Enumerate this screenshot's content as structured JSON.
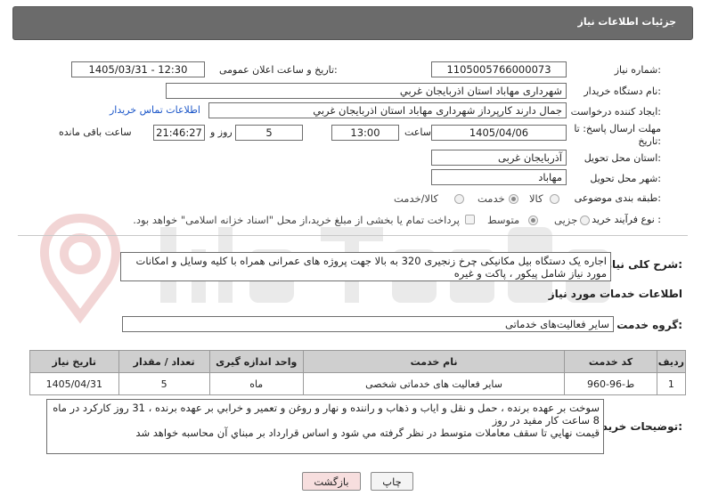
{
  "header": {
    "title": "جزئیات اطلاعات نیاز"
  },
  "form": {
    "need_number": {
      "label": "شماره نیاز:",
      "value": "1105005766000073"
    },
    "announce_datetime": {
      "label": "تاریخ و ساعت اعلان عمومی:",
      "value": "1405/03/31 - 12:30"
    },
    "buyer_org": {
      "label": "نام دستگاه خریدار:",
      "value": "شهرداری مهاباد استان اذربایجان غربي"
    },
    "requester": {
      "label": "ایجاد کننده درخواست:",
      "value": "جمال دارند کارپرداز  شهرداری مهاباد استان اذربایجان غربي",
      "contact_link": "اطلاعات تماس خریدار"
    },
    "deadline": {
      "label_line1": "مهلت ارسال پاسخ: تا",
      "label_line2": "تاریخ:",
      "date": "1405/04/06",
      "time_label": "ساعت",
      "time": "13:00",
      "days": "5",
      "days_label": "روز و",
      "remaining": "21:46:27",
      "remaining_label": "ساعت باقی مانده"
    },
    "province": {
      "label": "استان محل تحویل:",
      "value": "آذربایجان غربی"
    },
    "city": {
      "label": "شهر محل تحویل:",
      "value": "مهاباد"
    },
    "category": {
      "label": "طبقه بندی موضوعی:",
      "options": [
        "کالا",
        "خدمت",
        "کالا/خدمت"
      ],
      "selected": "خدمت"
    },
    "purchase_type": {
      "label": "نوع فرآیند خرید :",
      "options": [
        "جزیی",
        "متوسط"
      ],
      "selected": "متوسط",
      "payment_note": "پرداخت تمام یا بخشی از مبلغ خرید،از محل \"اسناد خزانه اسلامی\" خواهد بود."
    }
  },
  "description": {
    "label": "شرح کلی نیاز:",
    "text": "اجاره یک دستگاه بیل مکانیکی چرخ زنجیری 320 به بالا جهت پروژه های عمرانی همراه با کلیه وسایل و امکانات مورد نیاز شامل پیکور ، پاکت و غیره"
  },
  "services": {
    "section_title": "اطلاعات خدمات مورد نیاز",
    "group_label": "گروه خدمت:",
    "group_value": "سایر فعالیت‌های خدماتی",
    "columns": [
      "ردیف",
      "کد خدمت",
      "نام خدمت",
      "واحد اندازه گیری",
      "تعداد / مقدار",
      "تاریخ نیاز"
    ],
    "rows": [
      {
        "row": "1",
        "code": "ط-96-960",
        "name": "سایر فعالیت های خدماتی شخصی",
        "unit": "ماه",
        "qty": "5",
        "date": "1405/04/31"
      }
    ]
  },
  "buyer_notes": {
    "label": "توضیحات خریدار:",
    "lines": [
      "سوخت بر عهده برنده ، حمل و نقل و اياب و ذهاب و راننده و نهار و روغن و تعمير و خرابي بر عهده برنده ، 31 روز كاركرد در ماه",
      "8 ساعت كار مفيد در روز",
      "قيمت نهايي تا سقف معاملات متوسط در نظر گرفته مي شود و اساس قرارداد بر مبناي آن محاسبه خواهد شد"
    ]
  },
  "buttons": {
    "print": "چاپ",
    "back": "بازگشت"
  },
  "colors": {
    "header_bg": "#6b6b6b",
    "link": "#1a55c8",
    "back_button_bg": "#f7dede"
  }
}
